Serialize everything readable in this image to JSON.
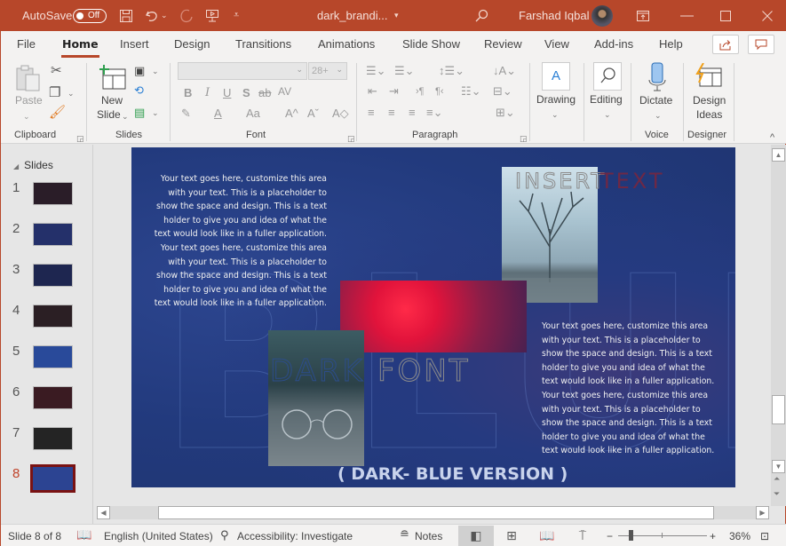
{
  "titlebar": {
    "autosave_label": "AutoSave",
    "autosave_state": "Off",
    "doc_title": "dark_brandi...",
    "user_name": "Farshad Iqbal",
    "icons": [
      "save-icon",
      "undo-icon",
      "redo-icon",
      "present-icon",
      "customize-qat-icon",
      "search-icon",
      "ribbon-display-icon",
      "minimize-icon",
      "maximize-icon",
      "close-icon"
    ]
  },
  "tabs": [
    "File",
    "Home",
    "Insert",
    "Design",
    "Transitions",
    "Animations",
    "Slide Show",
    "Review",
    "View",
    "Add-ins",
    "Help"
  ],
  "active_tab": "Home",
  "ribbon": {
    "clipboard": {
      "paste": "Paste",
      "label": "Clipboard"
    },
    "slides": {
      "new_slide_1": "New",
      "new_slide_2": "Slide",
      "label": "Slides"
    },
    "font": {
      "font_name": "",
      "font_size": "28+",
      "label": "Font",
      "buttons": [
        "B",
        "I",
        "U",
        "S",
        "ab",
        "AV",
        "Aa"
      ]
    },
    "paragraph": {
      "label": "Paragraph"
    },
    "drawing": {
      "label": "Drawing"
    },
    "editing": {
      "label": "Editing"
    },
    "voice": {
      "dictate": "Dictate",
      "label": "Voice"
    },
    "designer": {
      "line1": "Design",
      "line2": "Ideas",
      "label": "Designer"
    }
  },
  "slides_panel": {
    "title": "Slides",
    "slides": [
      {
        "num": "1",
        "bg": "#2a1d28"
      },
      {
        "num": "2",
        "bg": "#24306a"
      },
      {
        "num": "3",
        "bg": "#1e2650"
      },
      {
        "num": "4",
        "bg": "#2b1f24"
      },
      {
        "num": "5",
        "bg": "#294a9a"
      },
      {
        "num": "6",
        "bg": "#3a1b22"
      },
      {
        "num": "7",
        "bg": "#242424"
      },
      {
        "num": "8",
        "bg": "#2c4492"
      }
    ],
    "active": "8"
  },
  "slide": {
    "left_paragraph": "Your text goes here, customize this area with your text. This is a placeholder to show the space and design. This is a text holder to give you and idea of what the text would look like in a fuller application. Your text goes here, customize this area with your text. This is a placeholder to show the space and design. This is a text holder to give you and idea of what the text would look like in a fuller application.",
    "right_paragraph": "Your text goes here, customize this area with your text. This is a placeholder to show the space and design. This is a text holder to give you and idea of what the text would look like in a fuller application. Your text goes here, customize this area with your text. This is a placeholder to show the space and design. This is a text holder to give you and idea of what the text would look like in a fuller application.",
    "insert_word": "INSERT",
    "text_word": "TEXT",
    "dark_word": "DARK",
    "font_word": "FONT",
    "watermark": "BLUE",
    "version": "( DARK- BLUE VERSION )"
  },
  "statusbar": {
    "slide_info": "Slide 8 of 8",
    "language": "English (United States)",
    "accessibility": "Accessibility: Investigate",
    "notes": "Notes",
    "zoom": "36%",
    "zoom_fraction": 0.36
  }
}
